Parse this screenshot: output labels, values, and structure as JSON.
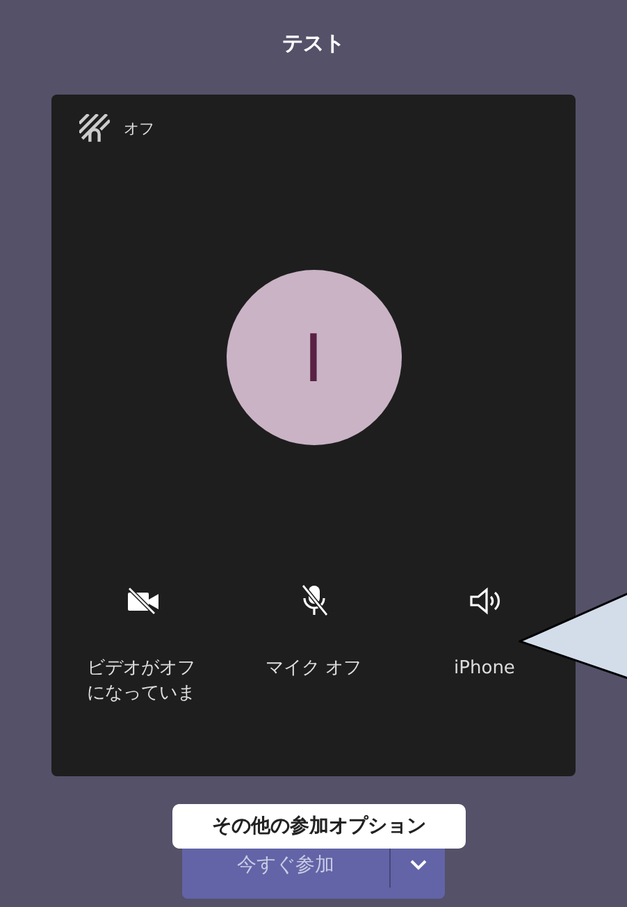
{
  "title": "テスト",
  "background_effects": {
    "label": "オフ"
  },
  "avatar": {
    "initial": "I"
  },
  "controls": [
    {
      "kind": "video",
      "label": "ビデオがオフになっていま",
      "off": true
    },
    {
      "kind": "mic",
      "label": "マイク オフ",
      "off": true
    },
    {
      "kind": "speaker",
      "label": "iPhone",
      "off": false
    }
  ],
  "tooltip": "その他の参加オプション",
  "join_button": {
    "label": "今すぐ参加"
  }
}
